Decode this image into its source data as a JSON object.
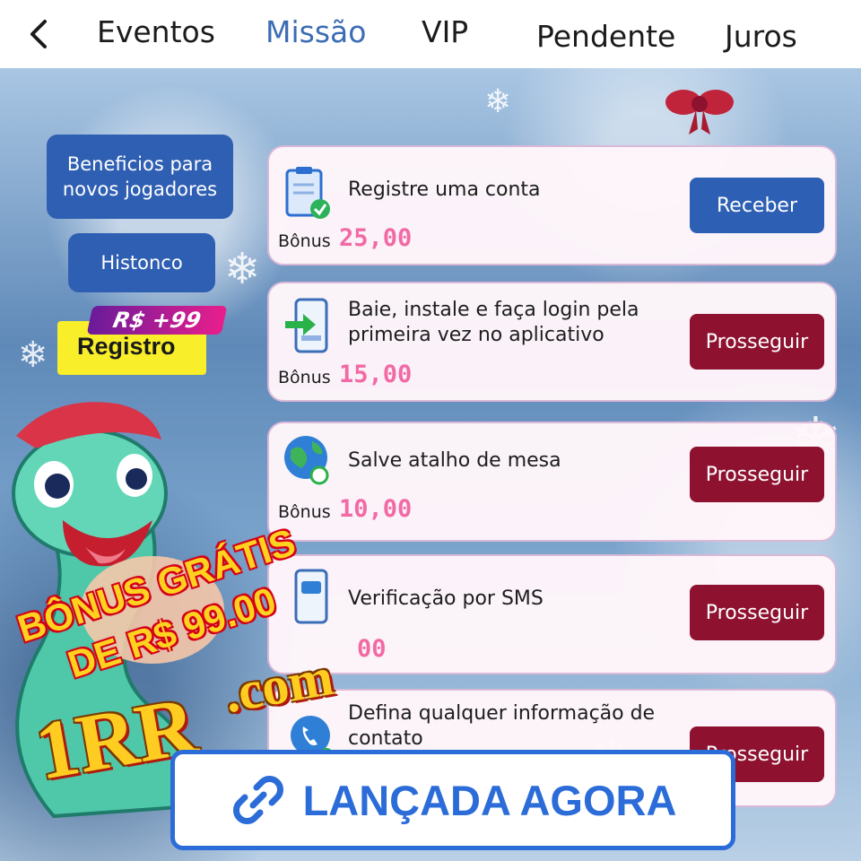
{
  "nav": {
    "back_icon": "chevron-left-icon",
    "tabs": [
      {
        "label": "Eventos",
        "active": false
      },
      {
        "label": "Missão",
        "active": true
      },
      {
        "label": "VIP",
        "active": false
      },
      {
        "label": "Pendente",
        "active": false
      },
      {
        "label": "Juros",
        "active": false
      }
    ]
  },
  "sidebar": {
    "beneficios_label_line1": "Beneficios para",
    "beneficios_label_line2": "novos jogadores",
    "historico_label": "Histonco"
  },
  "register_badge": {
    "tag": "R$ +99",
    "label": "Registro"
  },
  "missions": [
    {
      "title": "Registre uma conta",
      "bonus_label": "Bônus",
      "bonus_value": "25,00",
      "action": "Receber",
      "icon": "clipboard-check-icon"
    },
    {
      "title": "Baie, instale e faça login pela primeira vez no aplicativo",
      "bonus_label": "Bônus",
      "bonus_value": "15,00",
      "action": "Prosseguir",
      "icon": "phone-download-icon"
    },
    {
      "title": "Salve atalho de mesa",
      "bonus_label": "Bônus",
      "bonus_value": "10,00",
      "action": "Prosseguir",
      "icon": "globe-link-icon"
    },
    {
      "title": "Verificação por SMS",
      "bonus_label": "",
      "bonus_value": "00",
      "action": "Prosseguir",
      "icon": "sms-phone-icon"
    },
    {
      "title": "Defina qualquer informação de contato",
      "bonus_label": "",
      "bonus_value": "",
      "action": "Prosseguir",
      "icon": "contact-phone-icon"
    }
  ],
  "promo": {
    "line1": "BÔNUS GRÁTIS",
    "line2": "DE R$ 99.00",
    "brand": "1RR",
    "brand_suffix": ".com"
  },
  "launch_button": {
    "label": "LANÇADA AGORA",
    "icon": "link-icon"
  },
  "colors": {
    "active_tab": "#3b6cb4",
    "primary_blue": "#2d5fb4",
    "action_red": "#8e1230",
    "bonus_pink": "#f26aa5"
  }
}
